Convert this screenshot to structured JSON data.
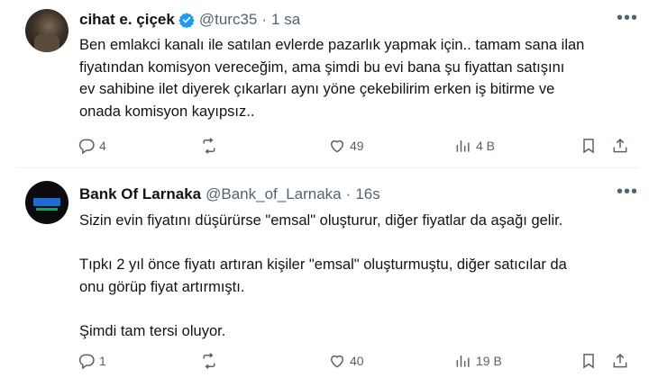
{
  "tweets": [
    {
      "name": "cihat e. çiçek",
      "handle": "@turc35",
      "separator": "·",
      "time": "1 sa",
      "more": "•••",
      "lines": [
        "Ben emlakci kanalı ile satılan evlerde pazarlık yapmak için.. tamam sana ilan",
        "fiyatından komisyon vereceğim,  ama şimdi bu evi bana şu fiyattan satışını",
        "ev sahibine ilet diyerek çıkarları aynı yöne çekebilirim erken iş bitirme ve",
        "onada komisyon kayıpsız.."
      ],
      "replies": "4",
      "retweets": "",
      "likes": "49",
      "views": "4 B",
      "icons": {
        "avatar": "avatar",
        "verified": "verified-badge-icon"
      }
    },
    {
      "name": "Bank Of Larnaka",
      "handle": "@Bank_of_Larnaka",
      "separator": "·",
      "time": "16s",
      "more": "•••",
      "lines": [
        "Sizin evin fiyatını düşürürse \"emsal\" oluşturur, diğer fiyatlar da aşağı gelir.",
        "Tıpkı 2 yıl önce fiyatı artıran kişiler \"emsal\" oluşturmuştu, diğer satıcılar da",
        "onu görüp fiyat artırmıştı.",
        "Şimdi tam tersi oluyor."
      ],
      "replies": "1",
      "retweets": "",
      "likes": "40",
      "views": "19 B"
    }
  ],
  "colors": {
    "accent": "#1d9bf0",
    "muted": "#536471",
    "text": "#0f1419",
    "divider": "#eff3f4"
  }
}
